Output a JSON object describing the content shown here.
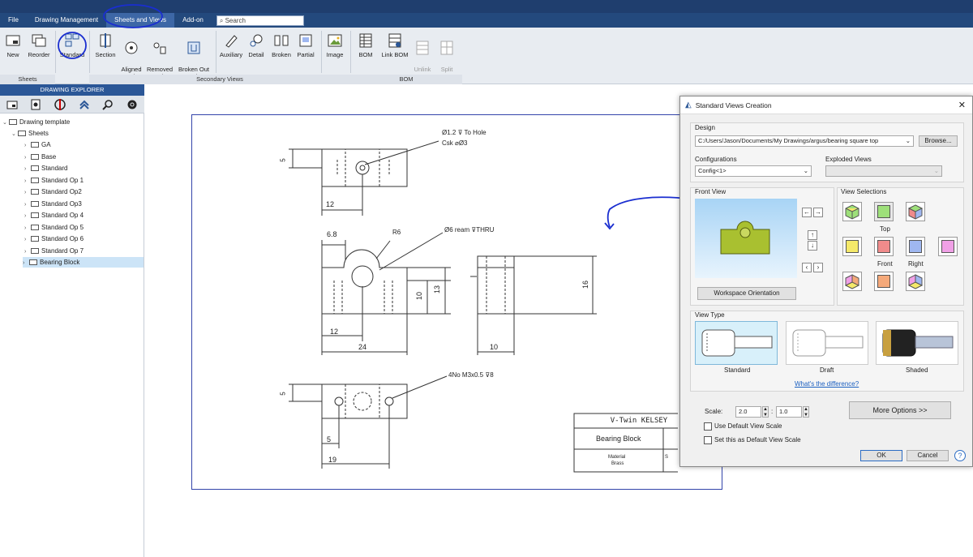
{
  "menubar": {
    "tabs": [
      {
        "label": "File"
      },
      {
        "label": "Drawing Management"
      },
      {
        "label": "Sheets and Views"
      },
      {
        "label": "Add-on"
      }
    ],
    "search_placeholder": "Search"
  },
  "ribbon": {
    "buttons": [
      {
        "label": "New"
      },
      {
        "label": "Reorder"
      },
      {
        "label": "Standard"
      },
      {
        "label": "Section"
      },
      {
        "label": "Aligned\nSection"
      },
      {
        "label": "Removed\nSection"
      },
      {
        "label": "Broken Out\nSection"
      },
      {
        "label": "Auxiliary"
      },
      {
        "label": "Detail"
      },
      {
        "label": "Broken"
      },
      {
        "label": "Partial"
      },
      {
        "label": "Image"
      },
      {
        "label": "BOM"
      },
      {
        "label": "Link BOM"
      },
      {
        "label": "Unlink\nBOM"
      },
      {
        "label": "Split\nBOM"
      }
    ],
    "groups": [
      {
        "label": "Sheets"
      },
      {
        "label": "Secondary Views"
      },
      {
        "label": "BOM"
      }
    ]
  },
  "explorer": {
    "title": "DRAWING EXPLORER",
    "tree": [
      {
        "label": "Drawing template"
      },
      {
        "label": "Sheets"
      },
      {
        "label": "GA"
      },
      {
        "label": "Base"
      },
      {
        "label": "Standard"
      },
      {
        "label": "Standard Op 1"
      },
      {
        "label": "Standard Op2"
      },
      {
        "label": "Standard Op3"
      },
      {
        "label": "Standard Op 4"
      },
      {
        "label": "Standard Op 5"
      },
      {
        "label": "Standard Op 6"
      },
      {
        "label": "Standard Op 7"
      },
      {
        "label": "Bearing Block"
      }
    ]
  },
  "drawing": {
    "dims": {
      "d5a": "5",
      "d12a": "12",
      "hole_note1": "Ø1.2 ⊽ To Hole",
      "hole_note2": "Csk ⌀Ø3",
      "d68": "6.8",
      "r6": "R6",
      "ream": "Ø6 ream ⊽THRU",
      "d10": "10",
      "d13": "13",
      "d12b": "12",
      "d24": "24",
      "d16": "16",
      "d10b": "10",
      "thread": "4No M3x0.5 ⊽8",
      "d5b": "5",
      "d5c": "5",
      "d19": "19"
    },
    "title_block": {
      "company": "V-Twin KELSEY",
      "part": "Bearing Block",
      "material_label": "Material",
      "material": "Brass",
      "scale_trunc": "S"
    }
  },
  "dialog": {
    "title": "Standard Views Creation",
    "design_label": "Design",
    "design_path": "C:/Users/Jason/Documents/My Drawings/argus/bearing square top",
    "browse": "Browse...",
    "configurations_label": "Configurations",
    "configuration_value": "Config<1>",
    "exploded_label": "Exploded Views",
    "front_view_label": "Front View",
    "workspace_orientation": "Workspace Orientation",
    "view_selections_label": "View Selections",
    "view_labels": {
      "top": "Top",
      "front": "Front",
      "right": "Right"
    },
    "view_type_label": "View Type",
    "view_types": [
      {
        "label": "Standard"
      },
      {
        "label": "Draft"
      },
      {
        "label": "Shaded"
      }
    ],
    "difference_link": "What's the difference?",
    "scale_label": "Scale:",
    "scale_num": "2.0",
    "scale_den": "1.0",
    "use_default": "Use Default View Scale",
    "set_default": "Set this as Default View Scale",
    "more_options": "More Options >>",
    "ok": "OK",
    "cancel": "Cancel",
    "help": "?"
  },
  "colors": {
    "menubar": "#23497d",
    "accent": "#2b5797",
    "annotation_ink": "#1a2ed0",
    "cube_yellow": "#f5e96a",
    "cube_green": "#9ee07a",
    "cube_red": "#f08b8b",
    "cube_blue": "#9fb7f0",
    "cube_pink": "#f0a0e6",
    "cube_orange": "#f5a97a"
  }
}
